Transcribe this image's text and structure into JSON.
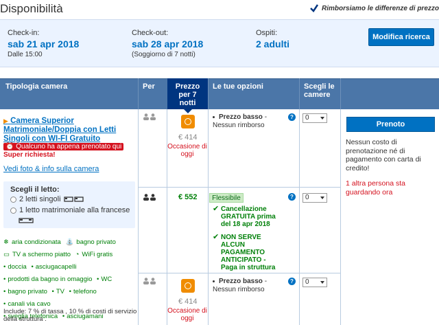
{
  "header": {
    "title": "Disponibilità",
    "refund_note": "Rimborsiamo le differenze di prezzo"
  },
  "search": {
    "checkin_label": "Check-in:",
    "checkin_value": "sab 21 apr 2018",
    "checkin_sub": "Dalle 15:00",
    "checkout_label": "Check-out:",
    "checkout_value": "sab 28 apr 2018",
    "checkout_sub": "(Soggiorno di 7 notti)",
    "guests_label": "Ospiti:",
    "guests_value": "2 adulti",
    "modify_button": "Modifica ricerca"
  },
  "table_headers": {
    "room_type": "Tipologia camera",
    "per": "Per",
    "price_line1": "Prezzo",
    "price_line2": "per 7",
    "price_line3": "notti",
    "options": "Le tue opzioni",
    "choose_line1": "Scegli le",
    "choose_line2": "camere"
  },
  "room": {
    "name": "Camera Superior Matrimoniale/Doppia con Letti Singoli con WI-FI Gratuito",
    "urgent_badge": "Qualcuno ha appena prenotato qui",
    "urgent_text": "Super richiesta!",
    "photos_link": "Vedi foto & info sulla camera",
    "bed_title": "Scegli il letto:",
    "bed_option_1": "2 letti singoli",
    "bed_option_2": "1 letto matrimoniale alla francese",
    "facilities": [
      "aria condizionata",
      "bagno privato",
      "TV a schermo piatto",
      "WiFi gratis",
      "doccia",
      "asciugacapelli",
      "prodotti da bagno in omaggio",
      "WC",
      "bagno privato",
      "TV",
      "telefono",
      "canali via cavo",
      "sveglia telefonica",
      "asciugamani"
    ],
    "note": "Include: 7 % di tassa , 10 % di costi di servizio della struttura ."
  },
  "rows": [
    {
      "price": "€ 414",
      "deal": "Occasione di oggi",
      "option_title": "Prezzo basso",
      "option_text": " - Nessun rimborso",
      "select_value": "0"
    },
    {
      "price": "€ 552",
      "flex_label": "Flessibile",
      "cancel_line1": "Cancellazione",
      "cancel_line2": "GRATUITA prima",
      "cancel_line3": "del 18 apr 2018",
      "pay_line1": "NON SERVE",
      "pay_line2": "ALCUN",
      "pay_line3": "PAGAMENTO",
      "pay_line4": "ANTICIPATO -",
      "pay_line5": "Paga in struttura",
      "select_value": "0"
    },
    {
      "price": "€ 414",
      "deal": "Occasione di oggi",
      "option_title": "Prezzo basso",
      "option_text": " - Nessun rimborso",
      "select_value": "0"
    }
  ],
  "booking": {
    "button": "Prenoto",
    "no_cost": "Nessun costo di prenotazione né di pagamento con carta di credito!",
    "others": "1 altra persona sta guardando ora"
  },
  "colors": {
    "brand_blue": "#003580",
    "link_blue": "#0071c2",
    "header_blue": "#4b76a8",
    "green": "#008009",
    "red": "#d4111e",
    "orange": "#f08c00"
  }
}
